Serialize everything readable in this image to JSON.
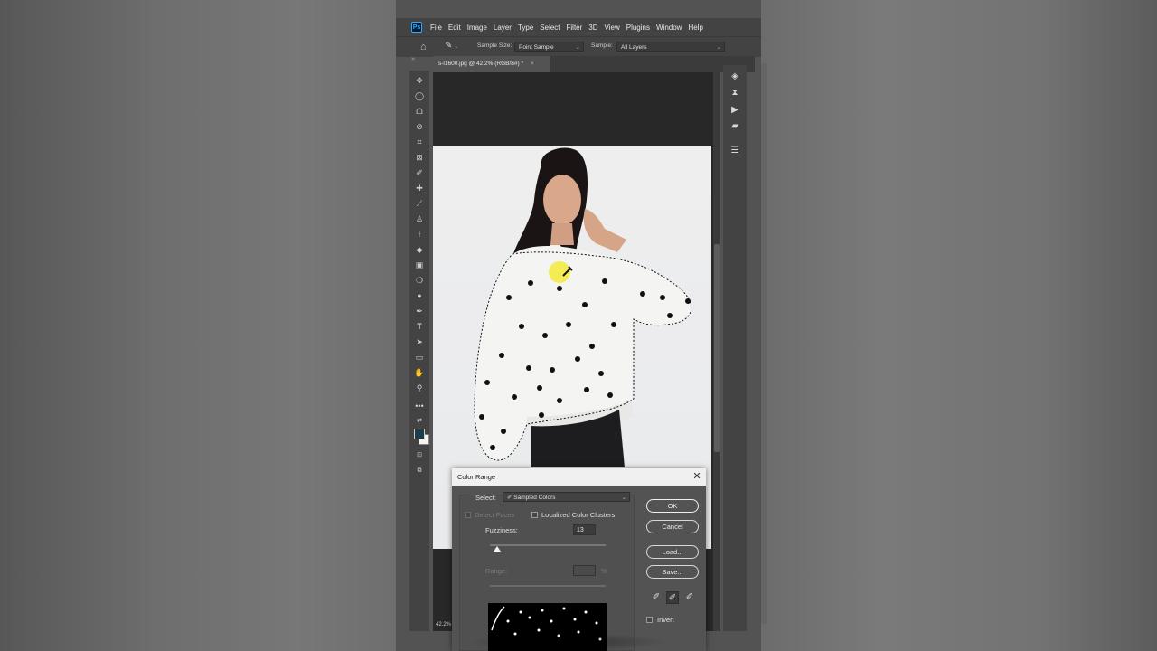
{
  "menubar": {
    "logo": "Ps",
    "items": [
      "File",
      "Edit",
      "Image",
      "Layer",
      "Type",
      "Select",
      "Filter",
      "3D",
      "View",
      "Plugins",
      "Window",
      "Help"
    ]
  },
  "options": {
    "sample_size_label": "Sample Size:",
    "sample_size_value": "Point Sample",
    "sample_label": "Sample:",
    "sample_value": "All Layers"
  },
  "document": {
    "tab_title": "s-l1600.jpg @ 42.2% (RGB/8#) *",
    "zoom": "42.2%"
  },
  "tools": [
    "move-icon",
    "marquee-icon",
    "lasso-icon",
    "quick-selection-icon",
    "crop-icon",
    "frame-icon",
    "eyedropper-icon",
    "healing-brush-icon",
    "brush-icon",
    "clone-stamp-icon",
    "history-brush-icon",
    "eraser-icon",
    "gradient-icon",
    "blur-icon",
    "dodge-icon",
    "pen-icon",
    "type-icon",
    "path-selection-icon",
    "rectangle-icon",
    "hand-icon",
    "zoom-icon",
    "more-tools-icon"
  ],
  "right_panel_icons": [
    "layers-icon",
    "history-icon",
    "play-icon",
    "comment-icon",
    "adjustments-icon"
  ],
  "dialog": {
    "title": "Color Range",
    "select_label": "Select:",
    "select_value": "Sampled Colors",
    "detect_faces": "Detect Faces",
    "localized_clusters": "Localized Color Clusters",
    "fuzziness_label": "Fuzziness:",
    "fuzziness_value": "13",
    "range_label": "Range:",
    "range_unit": "%",
    "ok": "OK",
    "cancel": "Cancel",
    "load": "Load...",
    "save": "Save...",
    "invert": "Invert"
  },
  "fuzziness_level": 0.06
}
